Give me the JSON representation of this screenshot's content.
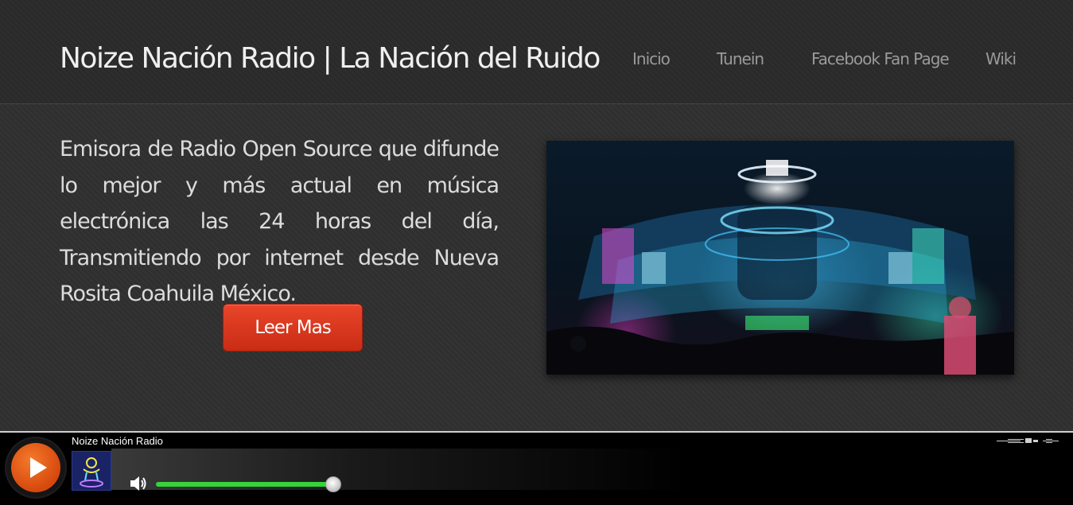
{
  "header": {
    "site_title": "Noize Nación Radio | La Nación del Ruido",
    "nav": [
      {
        "label": "Inicio"
      },
      {
        "label": "Tunein"
      },
      {
        "label": "Facebook Fan Page"
      },
      {
        "label": "Wiki"
      }
    ]
  },
  "main": {
    "intro_text": "Emisora de Radio Open Source que difunde lo mejor y más actual en música electrónica las 24 horas del día, Transmitiendo por internet desde Nueva Rosita Coahuila México.",
    "cta_label": "Leer Mas",
    "hero_image": {
      "description_icon": "concert-stage-image"
    }
  },
  "player": {
    "station_name": "Noize Nación Radio",
    "state": "paused",
    "volume_fraction": 0.95,
    "colors": {
      "play_button": "#e05a18",
      "volume_fill": "#36d33a",
      "cta": "#d93a1f"
    }
  }
}
